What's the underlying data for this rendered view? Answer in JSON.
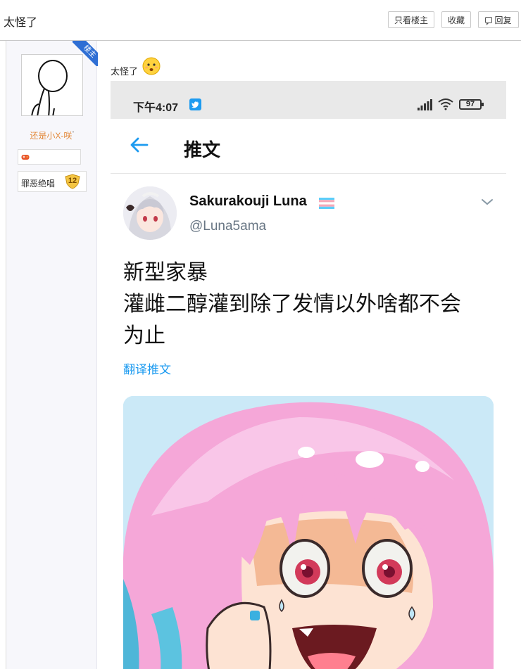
{
  "thread": {
    "title": "太怪了",
    "buttons": {
      "only_op": "只看楼主",
      "favorite": "收藏",
      "reply": "回复"
    }
  },
  "user": {
    "badge": "楼主",
    "name": "还是小X-咲",
    "name_mark": "°",
    "tag": "罪恶绝唱",
    "level": "12"
  },
  "post": {
    "text": "太怪了"
  },
  "tweet": {
    "status_time": "下午4:07",
    "battery": "97",
    "header_title": "推文",
    "author_name": "Sakurakouji Luna",
    "author_handle": "@Luna5ama",
    "lines": [
      "新型家暴",
      "灌雌二醇灌到除了发情以外啥都不会",
      "为止"
    ],
    "translate_label": "翻译推文"
  },
  "colors": {
    "link_blue": "#1d9bf0",
    "op_badge": "#2f6fd4",
    "username": "#e3893a"
  }
}
